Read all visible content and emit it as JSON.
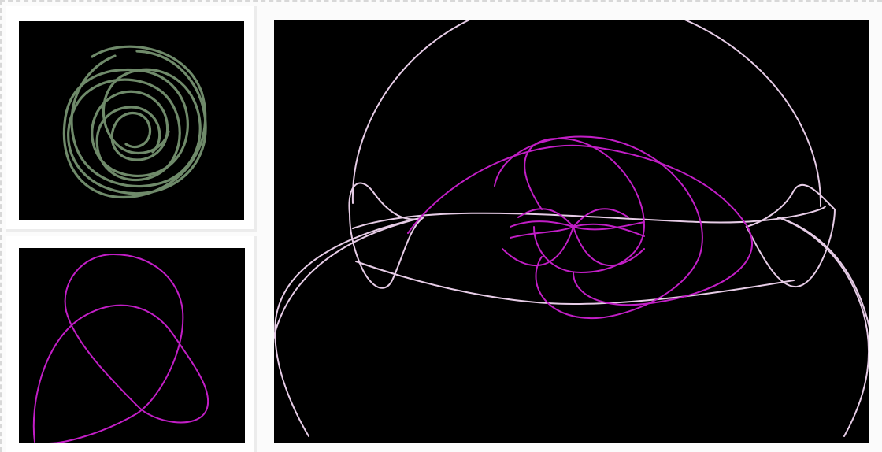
{
  "colors": {
    "background": "#000000",
    "thumb1_curve": "#6f8a6a",
    "thumb2_curve": "#c21ec6",
    "main_outer_curve": "#e6cce6",
    "main_inner_curve": "#c21ec6",
    "workspace": "#fbfbfb"
  },
  "icons": {
    "thumb1": "curve-thumbnail",
    "thumb2": "curve-thumbnail",
    "main": "curve-canvas"
  }
}
